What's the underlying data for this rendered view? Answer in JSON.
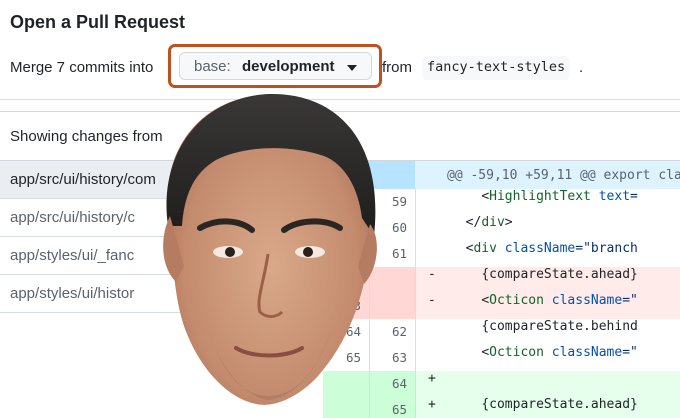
{
  "page": {
    "title": "Open a Pull Request"
  },
  "compare": {
    "merge_text": "Merge 7 commits into",
    "base_label": "base:",
    "base_branch": "development",
    "from_text": "from",
    "head_branch": "fancy-text-styles",
    "period": "."
  },
  "summary": {
    "text": "Showing changes from"
  },
  "files": [
    {
      "path": "app/src/ui/history/com"
    },
    {
      "path": "app/src/ui/history/c"
    },
    {
      "path": "app/styles/ui/_fanc"
    },
    {
      "path": "app/styles/ui/histor"
    }
  ],
  "diff": {
    "hunk_header": "@@ -59,10 +59,11 @@ export cla",
    "rows": [
      {
        "type": "ctx",
        "old": "",
        "new": "59",
        "sign": "",
        "indent": "  ",
        "open": "<",
        "tag": "HighlightText",
        "attr": " text",
        "rest": "="
      },
      {
        "type": "ctx",
        "old": "",
        "new": "60",
        "sign": "",
        "indent": "",
        "open": "</",
        "tag": "div",
        "attr": "",
        "rest": ">"
      },
      {
        "type": "ctx",
        "old": "",
        "new": "61",
        "sign": "",
        "indent": "",
        "open": "<",
        "tag": "div",
        "attr": " className",
        "rest": "=\"branch"
      },
      {
        "type": "del",
        "old": "",
        "new": "",
        "sign": "-",
        "indent": "  ",
        "open": "",
        "tag": "",
        "attr": "",
        "rest": "{compareState.ahead}"
      },
      {
        "type": "del",
        "old": "63",
        "new": "",
        "sign": "-",
        "indent": "  ",
        "open": "<",
        "tag": "Octicon",
        "attr": " className",
        "rest": "=\""
      },
      {
        "type": "ctx",
        "old": "64",
        "new": "62",
        "sign": "",
        "indent": "  ",
        "open": "",
        "tag": "",
        "attr": "",
        "rest": "{compareState.behind"
      },
      {
        "type": "ctx",
        "old": "65",
        "new": "63",
        "sign": "",
        "indent": "  ",
        "open": "<",
        "tag": "Octicon",
        "attr": " className",
        "rest": "=\""
      },
      {
        "type": "add",
        "old": "",
        "new": "64",
        "sign": "+",
        "indent": "",
        "open": "",
        "tag": "",
        "attr": "",
        "rest": ""
      },
      {
        "type": "add",
        "old": "",
        "new": "65",
        "sign": "+",
        "indent": "  ",
        "open": "",
        "tag": "",
        "attr": "",
        "rest": "{compareState.ahead}"
      }
    ]
  },
  "colors": {
    "accent_outline": "#c2501e",
    "deletion": "#ffebe9",
    "addition": "#e6ffec",
    "hunk": "#ddf4ff"
  },
  "icons": {
    "expand": "unfold-up-icon",
    "caret": "triangle-down-icon"
  }
}
